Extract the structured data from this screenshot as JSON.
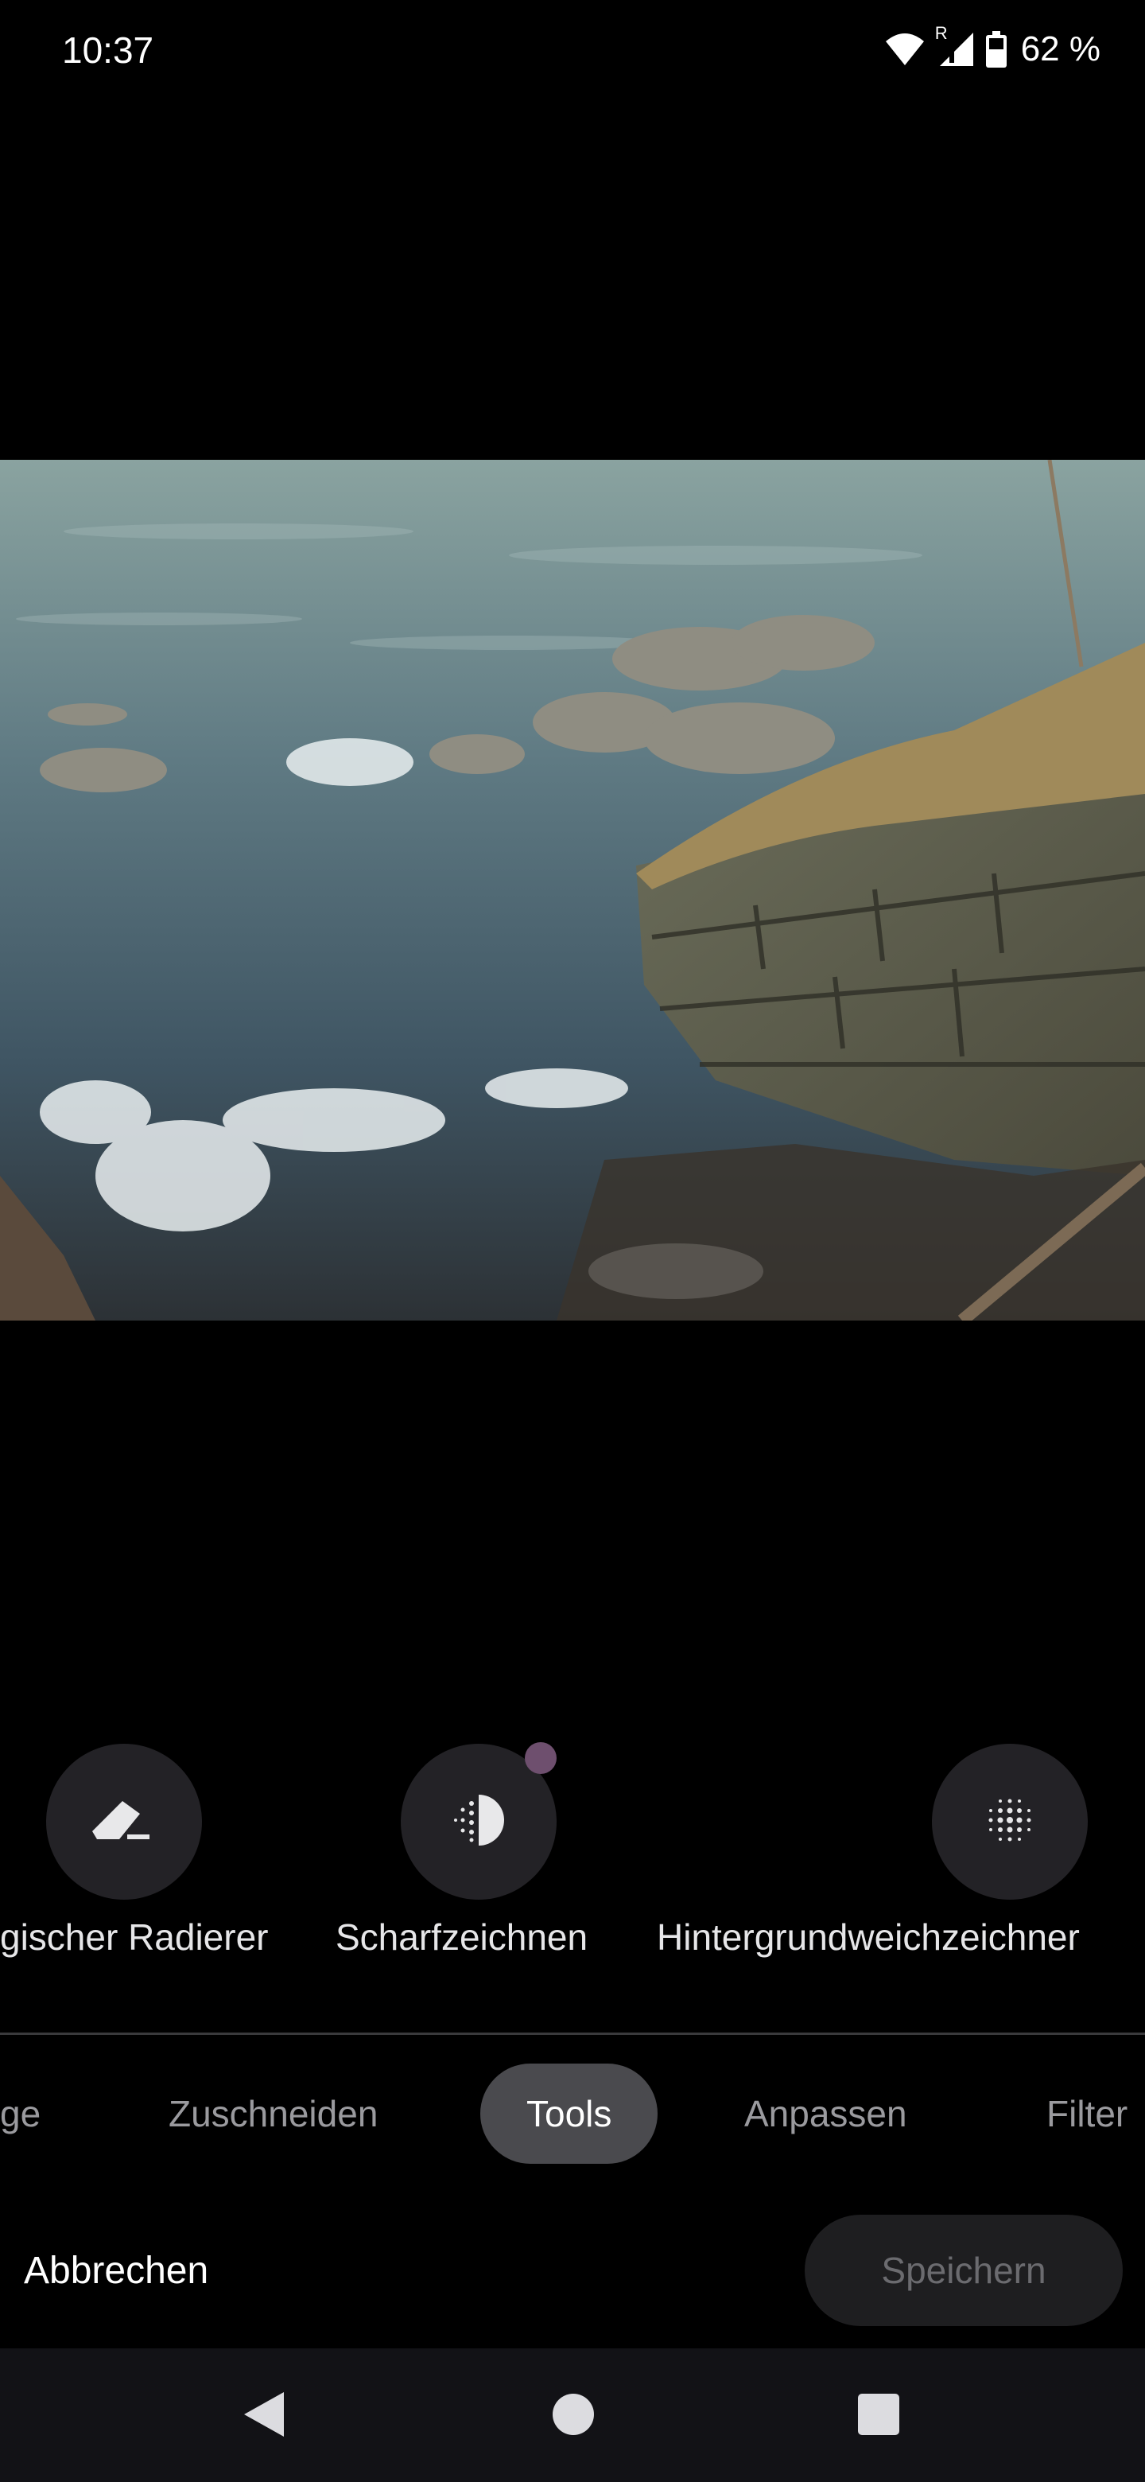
{
  "status_bar": {
    "time": "10:37",
    "roaming_indicator": "R",
    "battery_percent": "62 %",
    "icons": [
      "wifi-icon",
      "signal-icon",
      "battery-icon"
    ]
  },
  "photo": {
    "subject_icon": "river-photo"
  },
  "tools": [
    {
      "label": "gischer Radierer",
      "icon": "eraser-icon"
    },
    {
      "label": "Scharfzeichnen",
      "icon": "sharpen-icon",
      "badge": "new-dot"
    },
    {
      "label": "Hintergrundweichzeichner",
      "icon": "background-blur-icon"
    }
  ],
  "tabs": [
    {
      "label": "ge",
      "active": false
    },
    {
      "label": "Zuschneiden",
      "active": false
    },
    {
      "label": "Tools",
      "active": true
    },
    {
      "label": "Anpassen",
      "active": false
    },
    {
      "label": "Filter",
      "active": false
    }
  ],
  "actions": {
    "cancel_label": "Abbrechen",
    "save_label": "Speichern"
  },
  "nav_bar": {
    "icons": [
      "back-icon",
      "home-icon",
      "recents-icon"
    ]
  },
  "colors": {
    "background": "#000000",
    "tool_circle": "#232226",
    "active_tab": "#4a4a4e",
    "badge": "#6e4f6e",
    "save_button": "#1e1e20",
    "nav_bar": "#121216"
  }
}
